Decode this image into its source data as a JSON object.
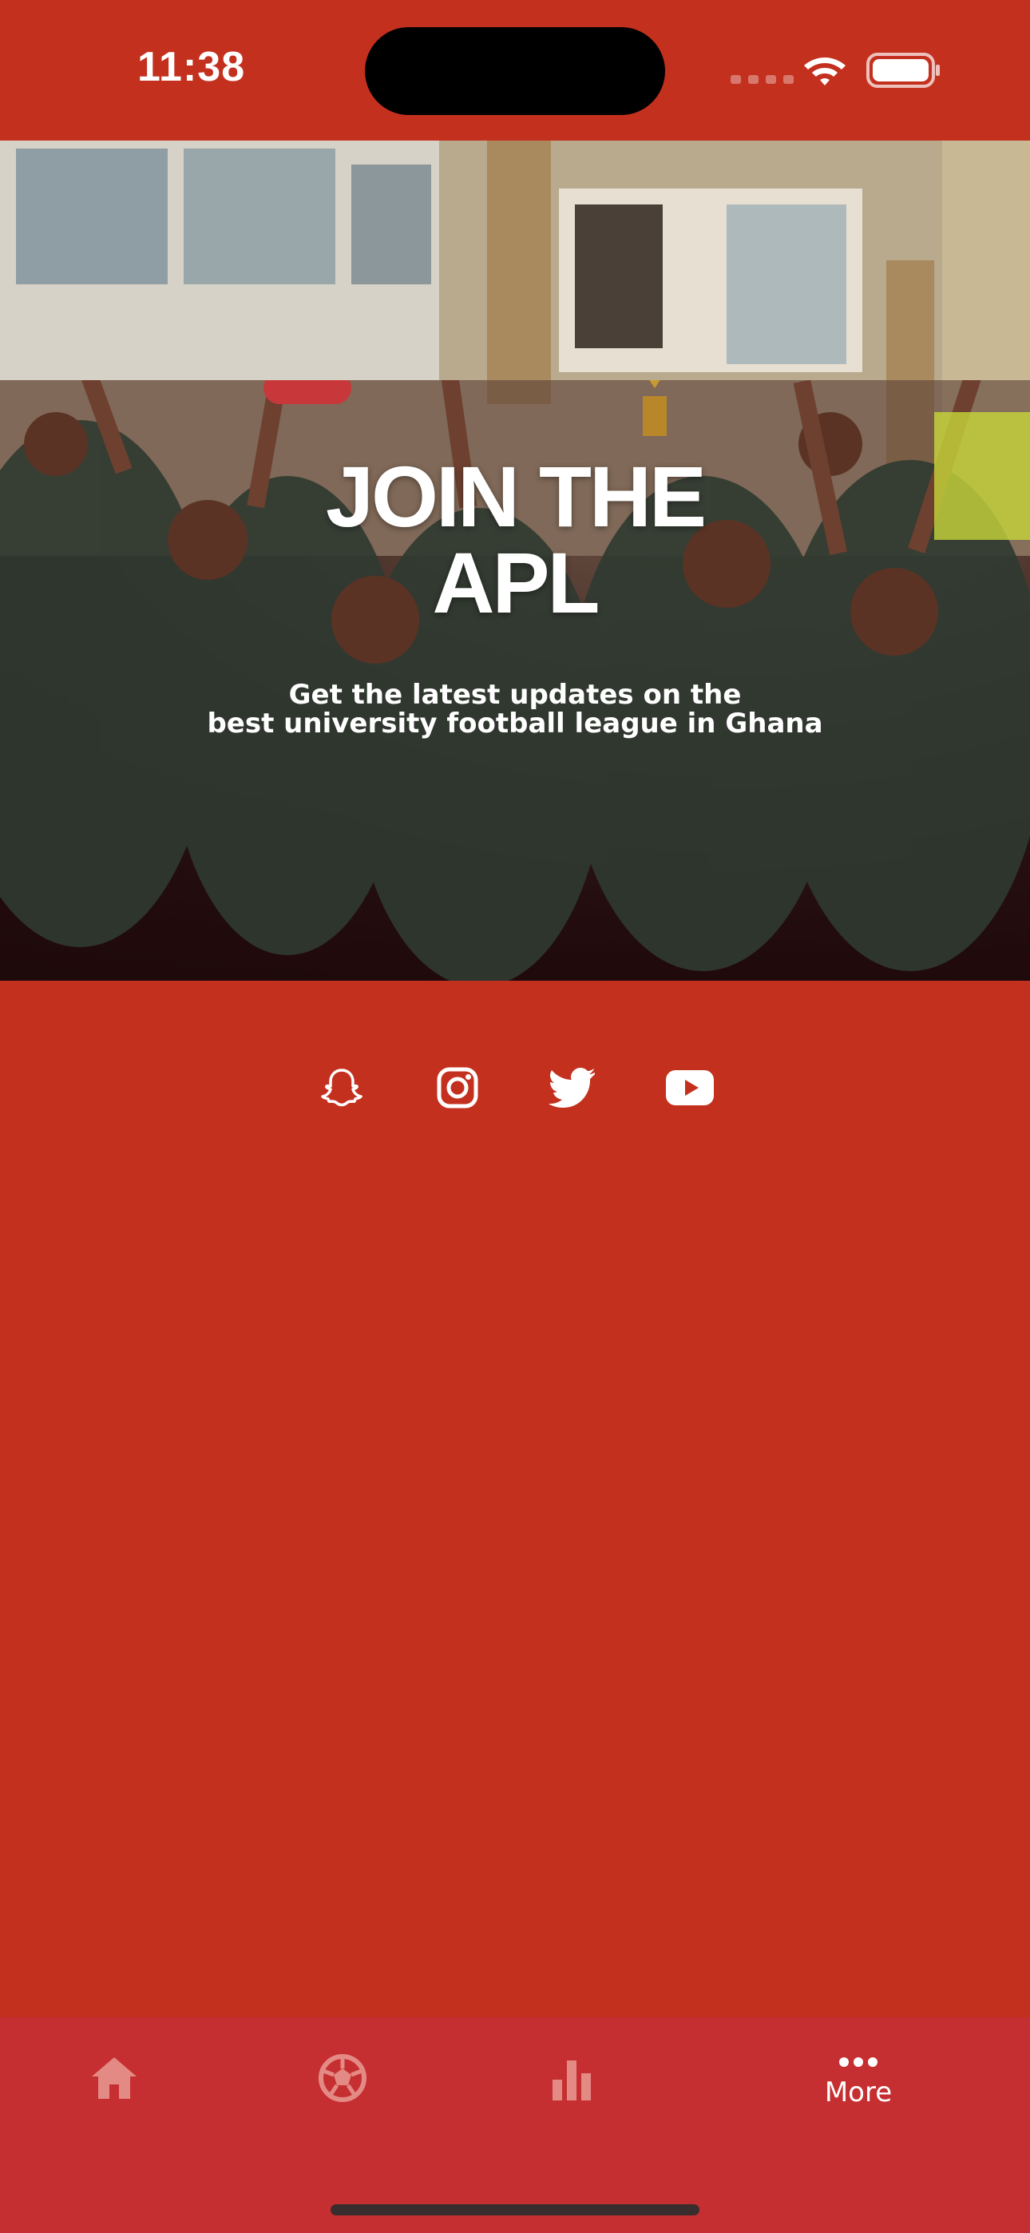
{
  "status_bar": {
    "time": "11:38",
    "icons": [
      "cellular-signal-icon",
      "wifi-icon",
      "battery-icon"
    ]
  },
  "hero": {
    "title_line1": "JOIN THE",
    "title_line2": "APL",
    "subtitle_line1": "Get the latest updates on the",
    "subtitle_line2": "best university football league in Ghana"
  },
  "social": {
    "items": [
      {
        "name": "snapchat",
        "icon": "snapchat-icon"
      },
      {
        "name": "instagram",
        "icon": "instagram-icon"
      },
      {
        "name": "twitter",
        "icon": "twitter-icon"
      },
      {
        "name": "youtube",
        "icon": "youtube-icon"
      }
    ]
  },
  "tab_bar": {
    "tabs": [
      {
        "icon": "home-icon",
        "label": ""
      },
      {
        "icon": "soccer-ball-icon",
        "label": ""
      },
      {
        "icon": "bar-chart-icon",
        "label": ""
      },
      {
        "icon": "more-dots-icon",
        "label": "More"
      }
    ],
    "active_index": 3
  },
  "colors": {
    "background": "#c4301e",
    "tab_bar": "#c52f31",
    "inactive_icon": "#e48a85",
    "active": "#ffffff"
  }
}
